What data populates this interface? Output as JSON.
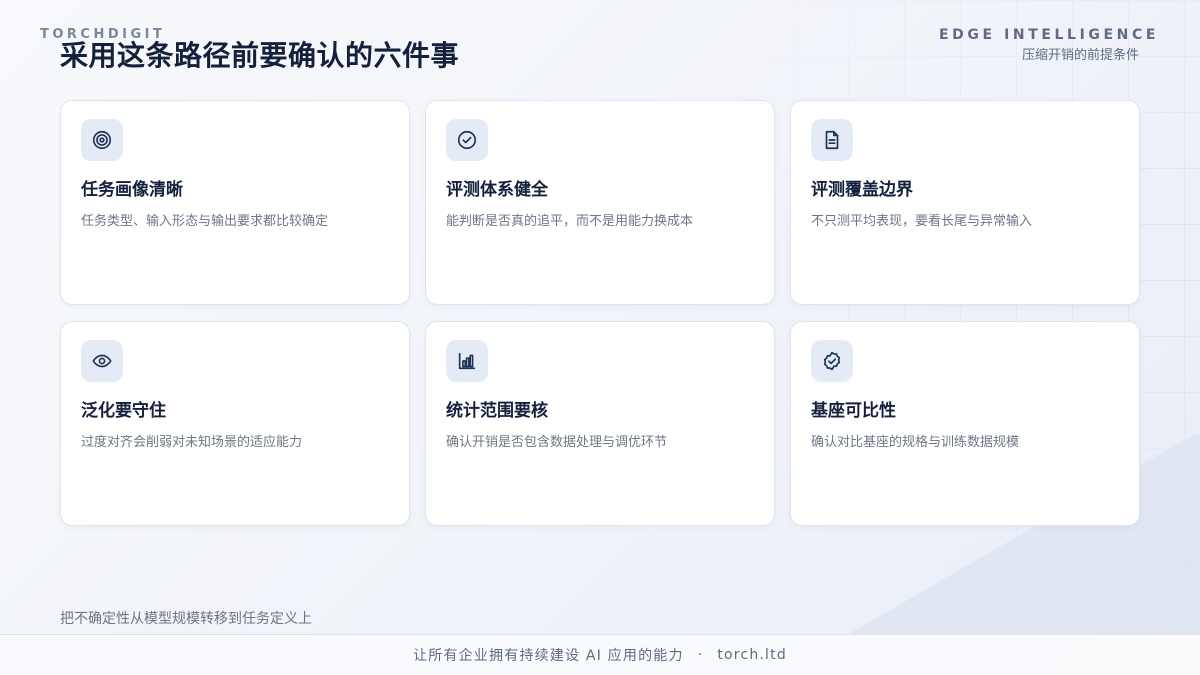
{
  "brand": "TORCHDIGIT",
  "page_title": "采用这条路径前要确认的六件事",
  "top_right": {
    "label": "EDGE INTELLIGENCE",
    "subtitle": "压缩开销的前提条件"
  },
  "cards": [
    {
      "icon": "target-icon",
      "title": "任务画像清晰",
      "desc": "任务类型、输入形态与输出要求都比较确定"
    },
    {
      "icon": "check-circle-icon",
      "title": "评测体系健全",
      "desc": "能判断是否真的追平，而不是用能力换成本"
    },
    {
      "icon": "document-icon",
      "title": "评测覆盖边界",
      "desc": "不只测平均表现，要看长尾与异常输入"
    },
    {
      "icon": "eye-icon",
      "title": "泛化要守住",
      "desc": "过度对齐会削弱对未知场景的适应能力"
    },
    {
      "icon": "bar-chart-icon",
      "title": "统计范围要核",
      "desc": "确认开销是否包含数据处理与调优环节"
    },
    {
      "icon": "badge-check-icon",
      "title": "基座可比性",
      "desc": "确认对比基座的规格与训练数据规模"
    }
  ],
  "footnote": "把不确定性从模型规模转移到任务定义上",
  "footer": {
    "text": "让所有企业拥有持续建设 AI 应用的能力",
    "separator": "·",
    "domain": "torch.ltd"
  },
  "colors": {
    "title": "#14213d",
    "icon_bg": "#e5ebf6",
    "icon_stroke": "#1f3358",
    "desc": "#6d768a"
  }
}
